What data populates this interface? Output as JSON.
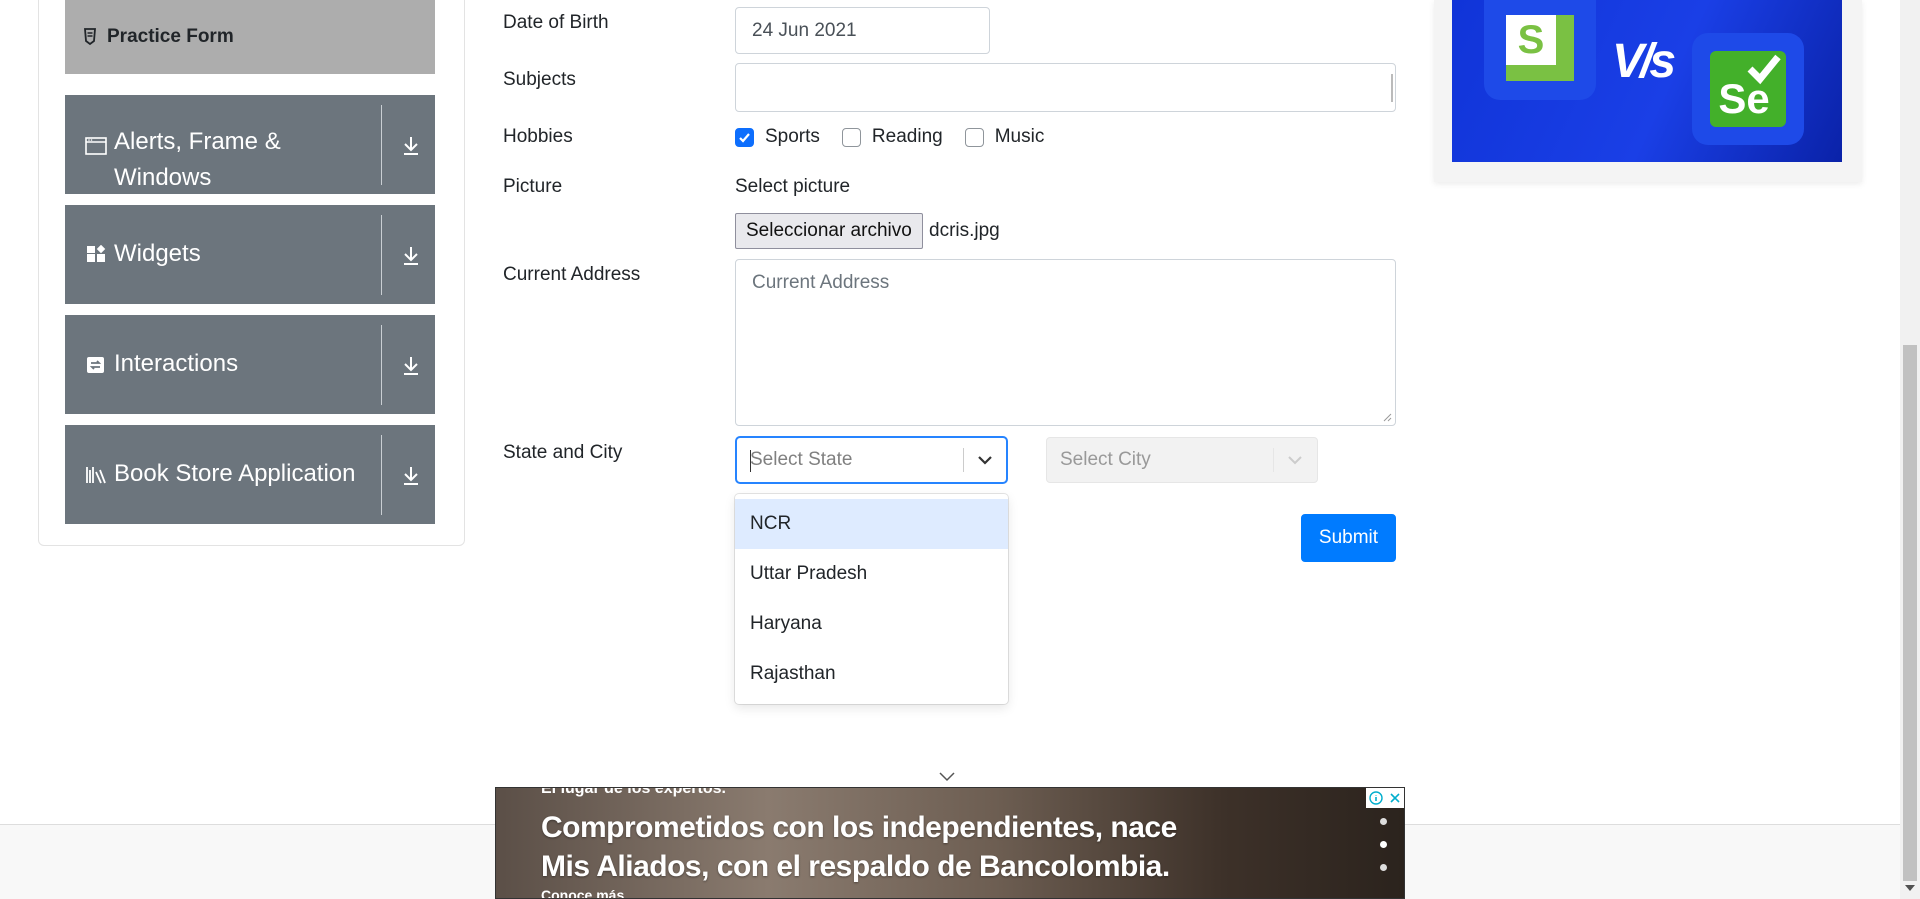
{
  "sidebar": {
    "active_item": "Practice Form",
    "groups": [
      {
        "label": "Alerts, Frame & Windows",
        "icon": "window-icon"
      },
      {
        "label": "Widgets",
        "icon": "widgets-icon"
      },
      {
        "label": "Interactions",
        "icon": "interactions-icon"
      },
      {
        "label": "Book Store Application",
        "icon": "books-icon"
      }
    ]
  },
  "form": {
    "dob": {
      "label": "Date of Birth",
      "value": "24 Jun 2021"
    },
    "subjects": {
      "label": "Subjects",
      "value": ""
    },
    "hobbies": {
      "label": "Hobbies",
      "options": [
        {
          "label": "Sports",
          "checked": true
        },
        {
          "label": "Reading",
          "checked": false
        },
        {
          "label": "Music",
          "checked": false
        }
      ]
    },
    "picture": {
      "label": "Picture",
      "hint": "Select picture",
      "button": "Seleccionar archivo",
      "filename": "dcris.jpg"
    },
    "address": {
      "label": "Current Address",
      "placeholder": "Current Address"
    },
    "state_city": {
      "label": "State and City",
      "state_placeholder": "Select State",
      "city_placeholder": "Select City",
      "state_options": [
        "NCR",
        "Uttar Pradesh",
        "Haryana",
        "Rajasthan"
      ],
      "focused_option": "NCR"
    },
    "submit_label": "Submit"
  },
  "ad": {
    "tagline": "El lugar de los expertos.",
    "headline_line1": "Comprometidos con los independientes, nace",
    "headline_line2": "Mis Aliados, con el respaldo de Bancolombia.",
    "more": "Conoce más"
  },
  "banner": {
    "left_logo_letter": "S",
    "right_logo_letters": "Se",
    "vs_text": "V/s"
  },
  "colors": {
    "sidebar_group_bg": "#6c757d",
    "active_item_bg": "#adadad",
    "primary": "#007bff",
    "focus_border": "#2684ff",
    "option_focus_bg": "#deebff",
    "banner_bg": "#1a3fe6",
    "logo_green": "#7ac143"
  }
}
